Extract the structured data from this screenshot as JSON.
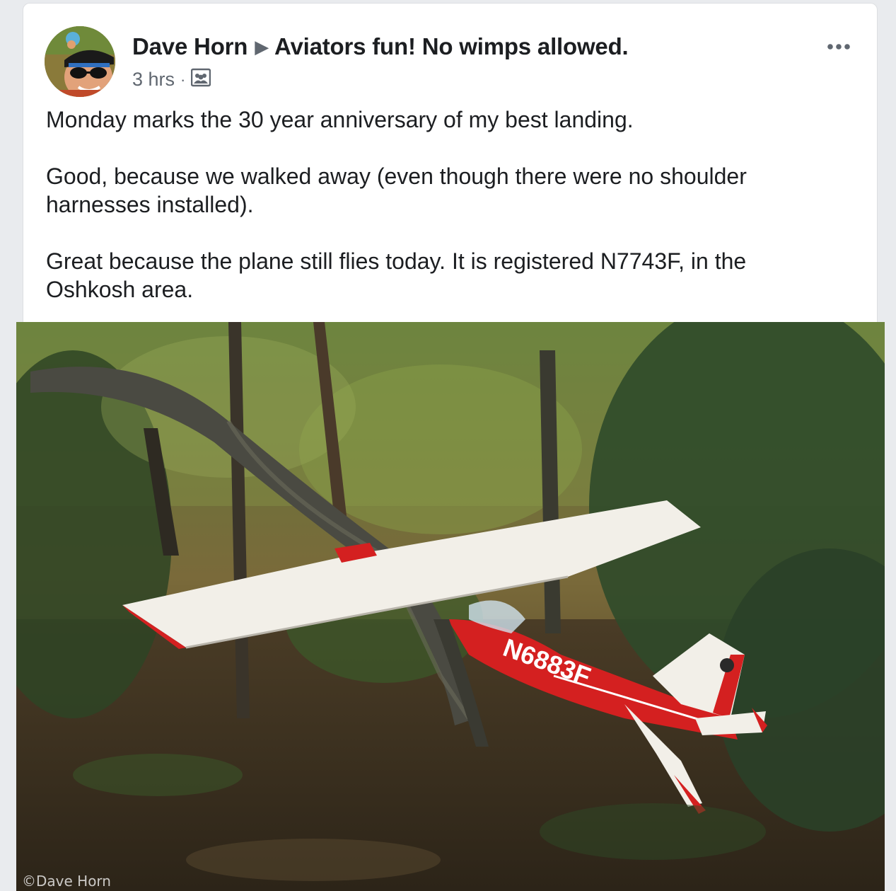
{
  "post": {
    "author": "Dave Horn",
    "group": "Aviators fun! No wimps allowed.",
    "timestamp": "3 hrs",
    "separator": "·",
    "privacy_icon": "group-icon",
    "more_icon": "more-options-icon",
    "paragraphs": [
      "Monday marks the 30 year anniversary of my best landing.",
      "Good, because we walked away (even though there were no shoulder harnesses installed).",
      "Great because the plane still flies today. It is registered N7743F, in the Oshkosh area."
    ],
    "photo": {
      "tail_number": "N6883F",
      "watermark": "©Dave Horn"
    }
  },
  "colors": {
    "background": "#e9ebee",
    "card": "#ffffff",
    "text": "#1c1e21",
    "secondary_text": "#606770",
    "plane_red": "#d42020"
  }
}
